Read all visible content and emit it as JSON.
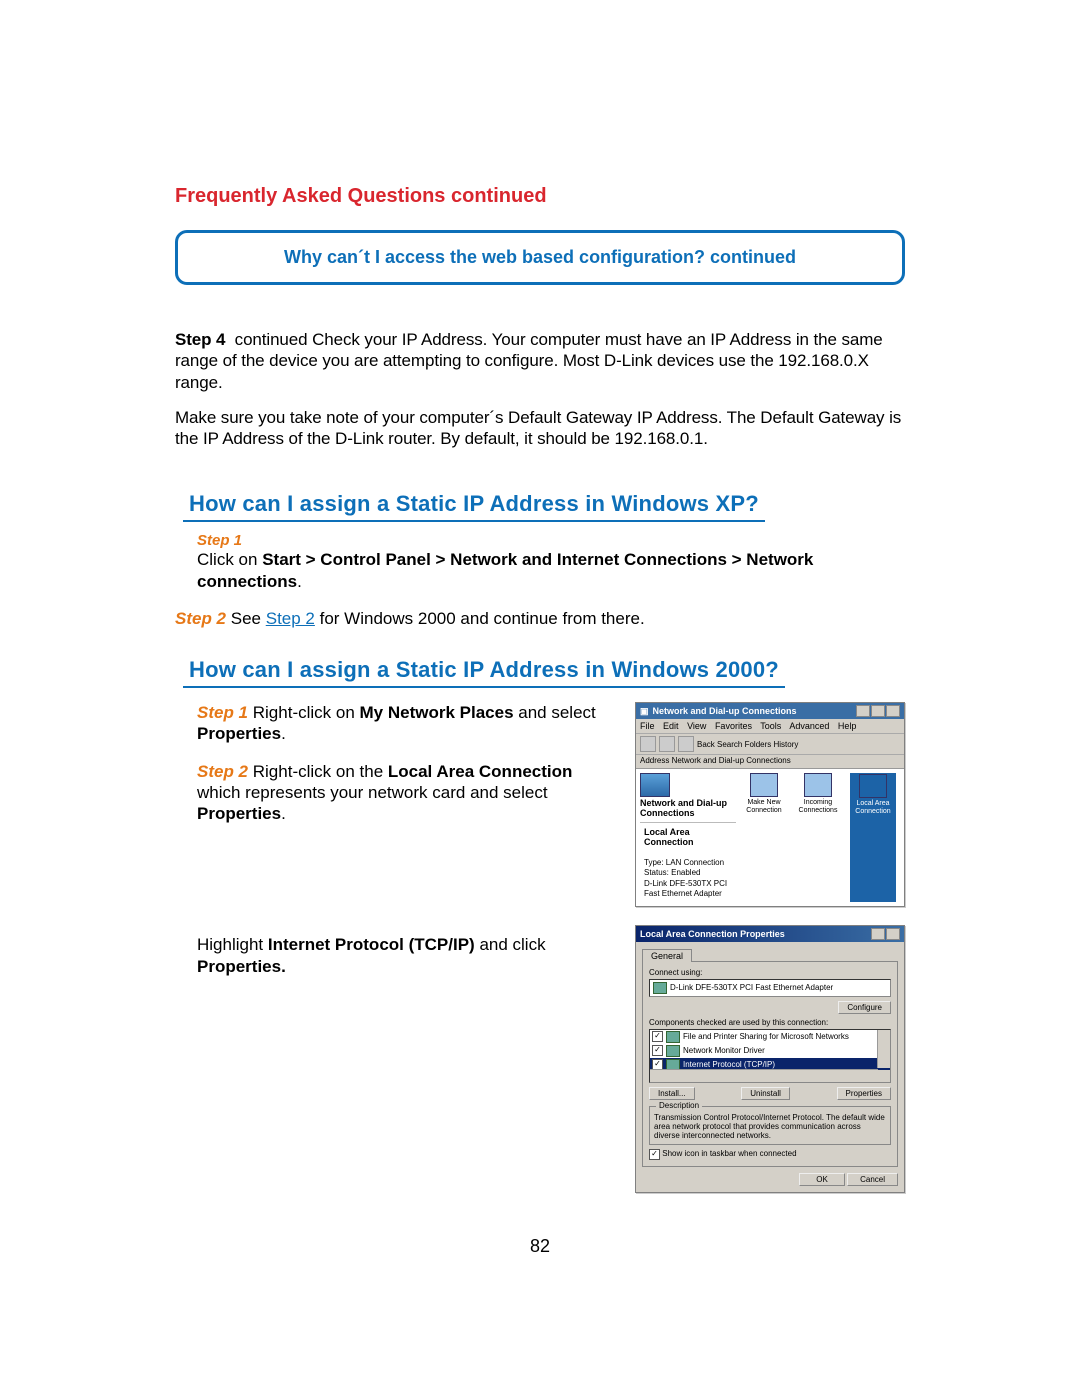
{
  "heading": "Frequently Asked Questions continued",
  "callout": "Why can´t I access the web based configuration? continued",
  "step4_label": "Step 4",
  "step4_cont": "continued",
  "step4_text_a": "Check your IP Address. Your computer must have an IP Address in the same range of the device you are attempting to configure. Most D-Link devices use the 192.168.0.X range.",
  "para2": "Make sure you take note of your computer´s Default Gateway IP Address. The Default Gateway is the IP Address of the D-Link router. By default, it should be 192.168.0.1.",
  "section_xp": "How can I assign a Static IP Address in Windows XP?",
  "xp_step1_label": "Step 1",
  "xp_step1_line_a": "Click on ",
  "xp_step1_bold": "Start > Control Panel > Network and Internet Connections > Network connections",
  "xp_step1_period": ".",
  "xp_step2_prefix": "Step 2",
  "xp_step2_a": " See ",
  "xp_step2_link": "Step 2",
  "xp_step2_b": " for Windows 2000 and continue from there.",
  "section_2000": "How can I assign a Static IP Address in Windows 2000?",
  "w2k_s1_label": "Step 1",
  "w2k_s1_a": " Right-click on ",
  "w2k_s1_b": "My Network Places",
  "w2k_s1_c": " and select ",
  "w2k_s1_d": "Properties",
  "w2k_s1_e": ".",
  "w2k_s2_label": "Step 2",
  "w2k_s2_a": " Right-click on the ",
  "w2k_s2_b": "Local Area Connection",
  "w2k_s2_c": " which represents your network card and select ",
  "w2k_s2_d": "Properties",
  "w2k_s2_e": ".",
  "w2k_hl_a": "Highlight ",
  "w2k_hl_b": "Internet Protocol (TCP/IP)",
  "w2k_hl_c": " and click ",
  "w2k_hl_d": "Properties.",
  "page_number": "82",
  "shot1": {
    "title": "Network and Dial-up Connections",
    "menu": [
      "File",
      "Edit",
      "View",
      "Favorites",
      "Tools",
      "Advanced",
      "Help"
    ],
    "toolbar_text": "Back    Search  Folders  History",
    "address": "Address  Network and Dial-up Connections",
    "left_heading": "Network and Dial-up Connections",
    "icons": [
      {
        "label": "Make New Connection"
      },
      {
        "label": "Incoming Connections"
      },
      {
        "label": "Local Area Connection"
      }
    ],
    "status_title": "Local Area Connection",
    "status_lines": [
      "Type: LAN Connection",
      "Status: Enabled",
      "D-Link DFE-530TX PCI Fast Ethernet Adapter"
    ]
  },
  "shot2": {
    "title": "Local Area Connection Properties",
    "tab": "General",
    "connect_label": "Connect using:",
    "adapter": "D-Link DFE-530TX PCI Fast Ethernet Adapter",
    "configure": "Configure",
    "components_label": "Components checked are used by this connection:",
    "items": [
      "File and Printer Sharing for Microsoft Networks",
      "Network Monitor Driver",
      "Internet Protocol (TCP/IP)"
    ],
    "btn_install": "Install...",
    "btn_uninstall": "Uninstall",
    "btn_props": "Properties",
    "desc_title": "Description",
    "desc_text": "Transmission Control Protocol/Internet Protocol. The default wide area network protocol that provides communication across diverse interconnected networks.",
    "show_icon": "Show icon in taskbar when connected",
    "ok": "OK",
    "cancel": "Cancel"
  }
}
